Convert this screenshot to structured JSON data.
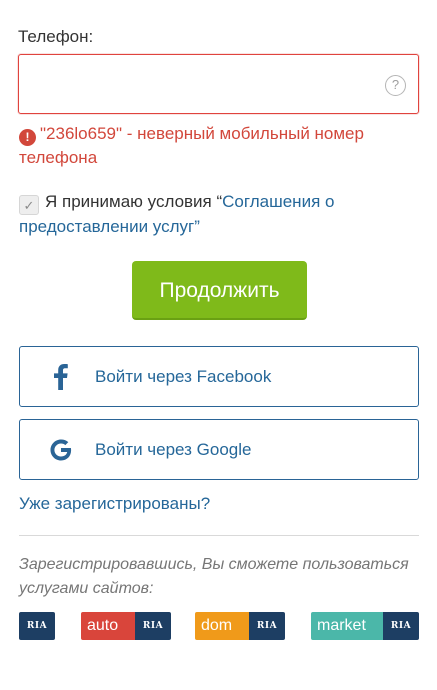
{
  "phone": {
    "label": "Телефон:",
    "value": "",
    "help_glyph": "?"
  },
  "error": {
    "glyph": "!",
    "message": "\"236lo659\" - неверный мобильный номер телефона"
  },
  "agreement": {
    "checked": true,
    "check_glyph": "✓",
    "prefix": "Я принимаю условия “",
    "link_text": "Соглашения о предоставлении услуг",
    "suffix": "”"
  },
  "continue_label": "Продолжить",
  "social": {
    "facebook_label": "Войти через Facebook",
    "google_label": "Войти через Google"
  },
  "already_registered": "Уже зарегистрированы?",
  "register_note": "Зарегистрировавшись, Вы сможете пользоваться услугами сайтов:",
  "sites": {
    "ria": "RIA",
    "auto": "auto",
    "dom": "dom",
    "market": "market"
  },
  "colors": {
    "error": "#d2473b",
    "link": "#256799",
    "primary_button": "#7fba1a"
  }
}
